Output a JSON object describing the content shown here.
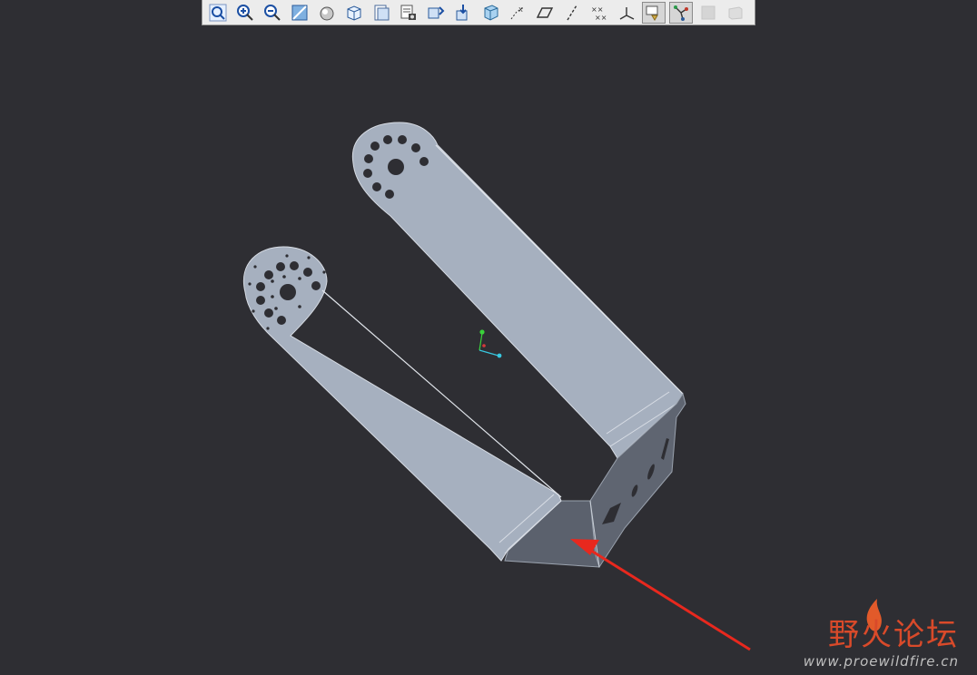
{
  "toolbar": {
    "buttons": [
      {
        "name": "zoom-window-icon"
      },
      {
        "name": "zoom-in-icon"
      },
      {
        "name": "zoom-out-icon"
      },
      {
        "name": "refit-icon"
      },
      {
        "name": "repaint-icon"
      },
      {
        "name": "orient-mode-icon"
      },
      {
        "name": "saved-views-icon"
      },
      {
        "name": "view-manager-icon"
      },
      {
        "name": "reorient-icon"
      },
      {
        "name": "spin-center-icon"
      },
      {
        "name": "display-style-icon"
      },
      {
        "name": "datum-axes-icon"
      },
      {
        "name": "datum-planes-icon"
      },
      {
        "name": "datum-axis-display-icon"
      },
      {
        "name": "datum-points-icon"
      },
      {
        "name": "coordinate-systems-icon"
      },
      {
        "name": "annotation-display-icon"
      },
      {
        "name": "sketch-selection-icon"
      },
      {
        "name": "shading-icon"
      },
      {
        "name": "render-icon"
      }
    ]
  },
  "watermark": {
    "title": "野火论坛",
    "url": "www.proewildfire.cn"
  },
  "colors": {
    "background": "#2e2e33",
    "part_face": "#a6b0bf",
    "part_dark_face": "#5f6571",
    "arrow": "#e8281e"
  }
}
